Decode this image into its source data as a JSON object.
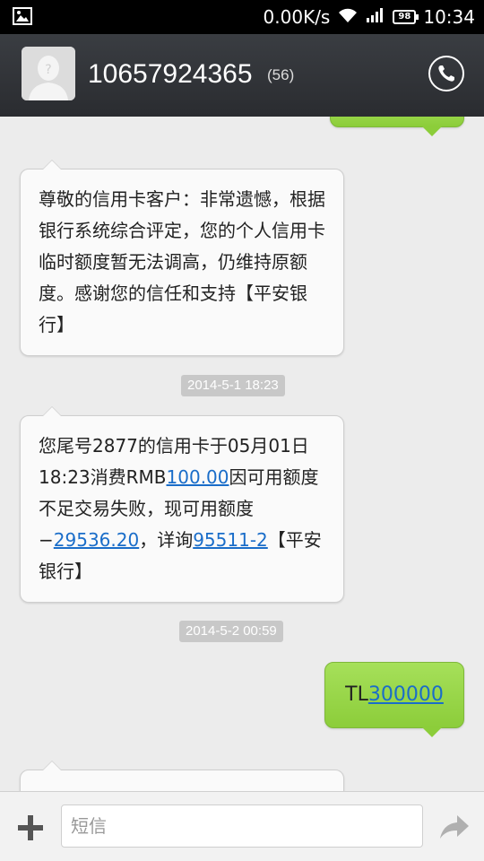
{
  "status_bar": {
    "net_speed": "0.00K/s",
    "battery": "98",
    "time": "10:34"
  },
  "header": {
    "contact": "10657924365",
    "count": "(56)"
  },
  "messages": {
    "m1": {
      "text": "尊敬的信用卡客户：非常遗憾，根据银行系统综合评定，您的个人信用卡临时额度暂无法调高，仍维持原额度。感谢您的信任和支持【平安银行】"
    },
    "t1": "2014-5-1 18:23",
    "m2": {
      "p1": "您尾号2877的信用卡于05月01日18:23消费RMB",
      "amount": "100.00",
      "p2": "因可用额度不足交易失败，现可用额度−",
      "balance": "29536.20",
      "p3": "，详询",
      "hotline": "95511-2",
      "p4": "【平安银行】"
    },
    "t2": "2014-5-2 00:59",
    "m3": {
      "prefix": "TL",
      "number": "300000"
    }
  },
  "composer": {
    "placeholder": "短信"
  },
  "colors": {
    "outgoing_bubble": "#9bd84b",
    "link": "#1a6dc9",
    "header_bg": "#33363a"
  }
}
